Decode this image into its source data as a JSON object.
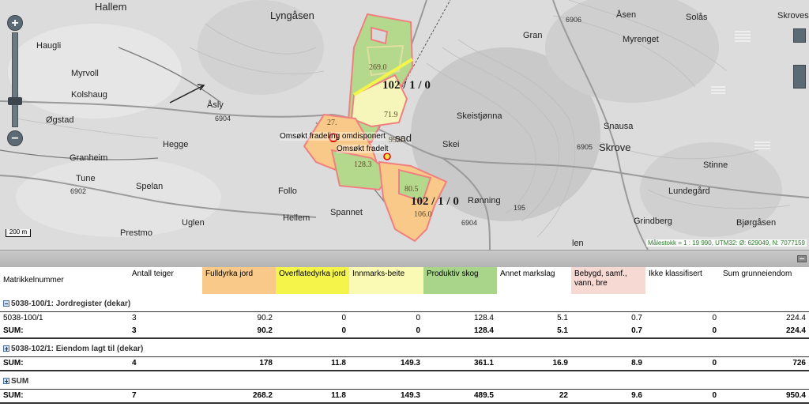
{
  "map": {
    "places": {
      "hallem_top": "Hallem",
      "lyngasen": "Lyngåsen",
      "haugli": "Haugli",
      "myrvoll": "Myrvoll",
      "kolshaug": "Kolshaug",
      "aasly": "Åsly",
      "ogstad": "Øgstad",
      "hegge": "Hegge",
      "granheim": "Granheim",
      "tune": "Tune",
      "spelan": "Spelan",
      "folio": "Follo",
      "hellem": "Hellem",
      "spannet": "Spannet",
      "prestmo": "Prestmo",
      "uglen": "Uglen",
      "gran": "Gran",
      "aasen": "Åsen",
      "solaas": "Solås",
      "skroves": "Skroves",
      "myrenget": "Myrenget",
      "skeistjonna": "Skeistjønna",
      "skei": "Skei",
      "snausa": "Snausa",
      "skrove": "Skrove",
      "stinne": "Stinne",
      "lundegard": "Lundegård",
      "ronning": "Rønning",
      "grindberg": "Grindberg",
      "bjorgaasen": "Bjørgåsen",
      "sad": "sad",
      "len": "len"
    },
    "roads": {
      "r6904a": "6904",
      "r6902": "6902",
      "r6906": "6906",
      "r6905": "6905",
      "r6904b": "6904",
      "r195": "195"
    },
    "parcels": {
      "p1": "102 / 1 / 0",
      "p2": "102 / 1 / 0"
    },
    "area_labels": {
      "a1": "269.0",
      "a2": "71.9",
      "a3": "27.",
      "a4": "128.3",
      "a5": "80.5",
      "a6": "106.0",
      "a7": "99.8"
    },
    "callouts": {
      "c1": "Omsøkt fradeling omdisponert",
      "c2": "Omsøkt fradelt"
    },
    "zoom_in": "+",
    "zoom_out": "−",
    "scale_bar": "200 m",
    "scale_info": "Målestokk = 1 : 19 990, UTM32: Ø: 629049, N: 7077159"
  },
  "table": {
    "headers": [
      "Matrikkelnummer",
      "Antall teiger",
      "Fulldyrka jord",
      "Overflatedyrka jord",
      "Innmarks-beite",
      "Produktiv skog",
      "Annet markslag",
      "Bebygd, samf., vann, bre",
      "Ikke klassifisert",
      "Sum grunneiendom"
    ],
    "header_colors": [
      "#ffffff",
      "#ffffff",
      "#f9c98a",
      "#f4f44a",
      "#fafab4",
      "#a8d58a",
      "#ffffff",
      "#f7d9d4",
      "#ffffff",
      "#ffffff"
    ],
    "groups": [
      {
        "title": "5038-100/1: Jordregister (dekar)",
        "expanded": true,
        "rows": [
          [
            "5038-100/1",
            "3",
            "90.2",
            "0",
            "0",
            "128.4",
            "5.1",
            "0.7",
            "0",
            "224.4"
          ]
        ],
        "sum": [
          "SUM:",
          "3",
          "90.2",
          "0",
          "0",
          "128.4",
          "5.1",
          "0.7",
          "0",
          "224.4"
        ]
      },
      {
        "title": "5038-102/1: Eiendom lagt til (dekar)",
        "expanded": false,
        "rows": [],
        "sum": [
          "SUM:",
          "4",
          "178",
          "11.8",
          "149.3",
          "361.1",
          "16.9",
          "8.9",
          "0",
          "726"
        ]
      },
      {
        "title": "SUM",
        "expanded": false,
        "rows": [],
        "sum": [
          "SUM:",
          "7",
          "268.2",
          "11.8",
          "149.3",
          "489.5",
          "22",
          "9.6",
          "0",
          "950.4"
        ]
      }
    ]
  }
}
